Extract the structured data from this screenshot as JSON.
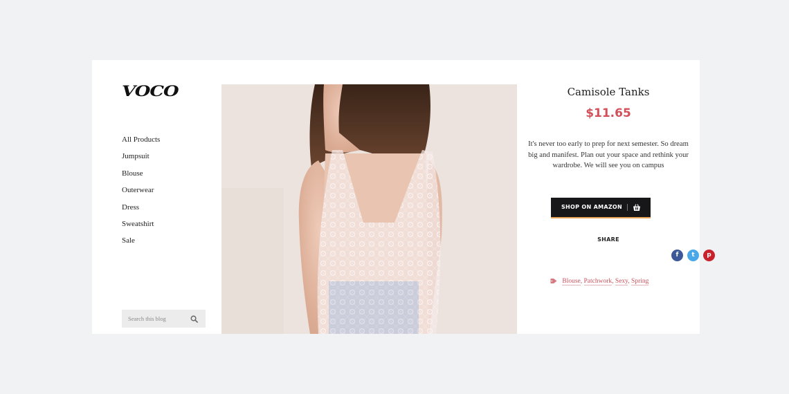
{
  "brand": {
    "logo_text": "VOCO"
  },
  "sidebar": {
    "nav_items": [
      {
        "label": "All Products"
      },
      {
        "label": "Jumpsuit"
      },
      {
        "label": "Blouse"
      },
      {
        "label": "Outerwear"
      },
      {
        "label": "Dress"
      },
      {
        "label": "Sweatshirt"
      },
      {
        "label": "Sale"
      }
    ],
    "search": {
      "placeholder": "Search this blog"
    }
  },
  "product": {
    "title": "Camisole Tanks",
    "price": "$11.65",
    "description": "It's never too early to prep for next semester. So dream big and manifest. Plan out your space and rethink your wardrobe. We will see you on campus",
    "shop_button_label": "SHOP ON AMAZON",
    "share_label": "SHARE",
    "social": [
      {
        "name": "facebook",
        "glyph": "f",
        "color": "#3b5998"
      },
      {
        "name": "twitter",
        "glyph": "t",
        "color": "#4aa8e8"
      },
      {
        "name": "pinterest",
        "glyph": "p",
        "color": "#c8232c"
      }
    ],
    "tags": [
      "Blouse",
      "Patchwork",
      "Sexy",
      "Spring"
    ]
  },
  "colors": {
    "accent": "#d2505a",
    "button_bg": "#17171a",
    "button_underline": "#e8a35a",
    "page_bg": "#f1f2f4"
  },
  "icons": {
    "search": "search-icon",
    "basket": "basket-icon",
    "tag": "tag-icon"
  }
}
